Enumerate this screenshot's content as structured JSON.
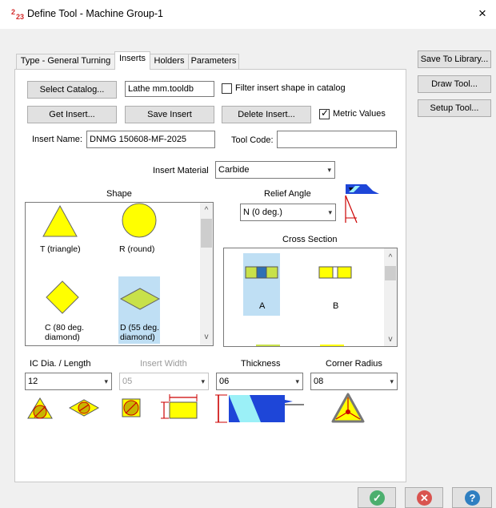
{
  "window": {
    "title": "Define Tool - Machine Group-1",
    "close_glyph": "×"
  },
  "tabs": [
    "Type - General Turning",
    "Inserts",
    "Holders",
    "Parameters"
  ],
  "right_buttons": [
    "Save To Library...",
    "Draw Tool...",
    "Setup Tool..."
  ],
  "insert": {
    "select_catalog": "Select Catalog...",
    "catalog_file": "Lathe mm.tooldb",
    "filter_label": "Filter insert shape in catalog",
    "get_insert": "Get Insert...",
    "save_insert": "Save Insert",
    "delete_insert": "Delete Insert...",
    "metric_label": "Metric Values",
    "name_label": "Insert Name:",
    "name_value": "DNMG 150608-MF-2025",
    "tool_code_label": "Tool Code:",
    "tool_code_value": "",
    "material_label": "Insert Material",
    "material_value": "Carbide"
  },
  "shape": {
    "label": "Shape",
    "items": [
      "T (triangle)",
      "R (round)",
      "C (80 deg. diamond)",
      "D (55 deg. diamond)"
    ],
    "selected": "D (55 deg. diamond)"
  },
  "relief": {
    "label": "Relief Angle",
    "value": "N (0 deg.)"
  },
  "cross_section": {
    "label": "Cross Section",
    "items": [
      "A",
      "B"
    ],
    "selected": "A"
  },
  "dims": {
    "ic_label": "IC Dia. / Length",
    "ic_value": "12",
    "width_label": "Insert Width",
    "width_value": "05",
    "thickness_label": "Thickness",
    "thickness_value": "06",
    "radius_label": "Corner Radius",
    "radius_value": "08"
  },
  "icons": {
    "app": "toolpath-app-icon",
    "ok": "checkmark-icon",
    "cancel": "cancel-x-icon",
    "help": "help-question-icon"
  },
  "colors": {
    "shape_fill": "#ffff00",
    "selection": "#bfdff4",
    "ok": "#4caf6e",
    "cancel": "#d9534f",
    "help": "#2f7fc1"
  }
}
